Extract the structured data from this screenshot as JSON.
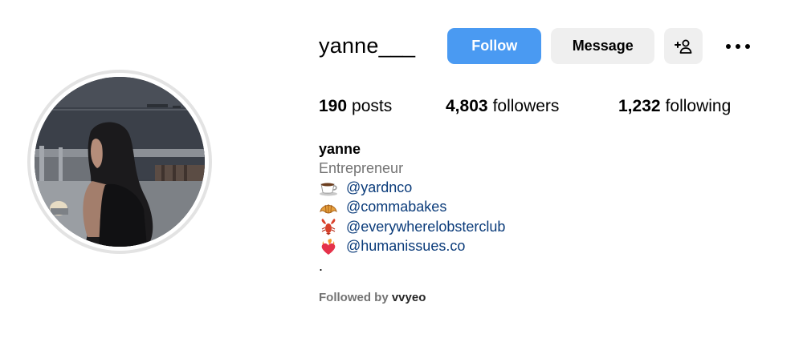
{
  "profile": {
    "username": "yanne___",
    "display_name": "yanne",
    "category": "Entrepreneur",
    "bio_end": "."
  },
  "actions": {
    "follow_label": "Follow",
    "message_label": "Message",
    "add_user_icon": "person-plus-icon",
    "more_icon": "more-dots-icon"
  },
  "stats": {
    "posts_count": "190",
    "posts_label": "posts",
    "followers_count": "4,803",
    "followers_label": "followers",
    "following_count": "1,232",
    "following_label": "following"
  },
  "bio_links": [
    {
      "emoji": "coffee-cup-icon",
      "handle": "@yardnco"
    },
    {
      "emoji": "croissant-icon",
      "handle": "@commabakes"
    },
    {
      "emoji": "lobster-icon",
      "handle": "@everywherelobsterclub"
    },
    {
      "emoji": "heart-on-fire-icon",
      "handle": "@humanissues.co"
    }
  ],
  "followed_by": {
    "prefix": "Followed by",
    "user": "vvyeo"
  },
  "colors": {
    "follow_button": "#4a9af2",
    "secondary_button": "#efefef",
    "mention_link": "#0a3b7a",
    "muted_text": "#737373"
  }
}
